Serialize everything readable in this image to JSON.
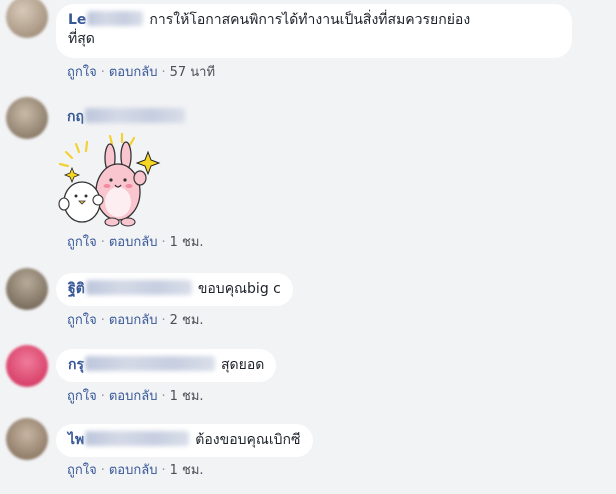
{
  "comments": [
    {
      "author": "Le",
      "text": "การให้โอกาสคนพิการได้ทำงานเป็นสิ่งที่สมควรยกย่อง",
      "text_line2": "ที่สุด",
      "like": "ถูกใจ",
      "reply": "ตอบกลับ",
      "time": "57 นาที",
      "avatar_color": "#b7a694"
    },
    {
      "author": "กฤ",
      "text": "",
      "like": "ถูกใจ",
      "reply": "ตอบกลับ",
      "time": "1 ชม.",
      "avatar_color": "#9c8d7c"
    },
    {
      "author": "ฐิติ",
      "text": "ขอบคุณbig c",
      "like": "ถูกใจ",
      "reply": "ตอบกลับ",
      "time": "2 ชม.",
      "avatar_color": "#8e8272"
    },
    {
      "author": "กรุ",
      "text": "สุดยอด",
      "like": "ถูกใจ",
      "reply": "ตอบกลับ",
      "time": "1 ชม.",
      "avatar_color": "#e0577f"
    },
    {
      "author": "ไพ",
      "text": "ต้องขอบคุณเบิกซี",
      "like": "ถูกใจ",
      "reply": "ตอบกลับ",
      "time": "1 ชม.",
      "avatar_color": "#a3917e"
    }
  ],
  "sticker": {
    "icon": "kanahei-rabbit-sticker-icon"
  }
}
